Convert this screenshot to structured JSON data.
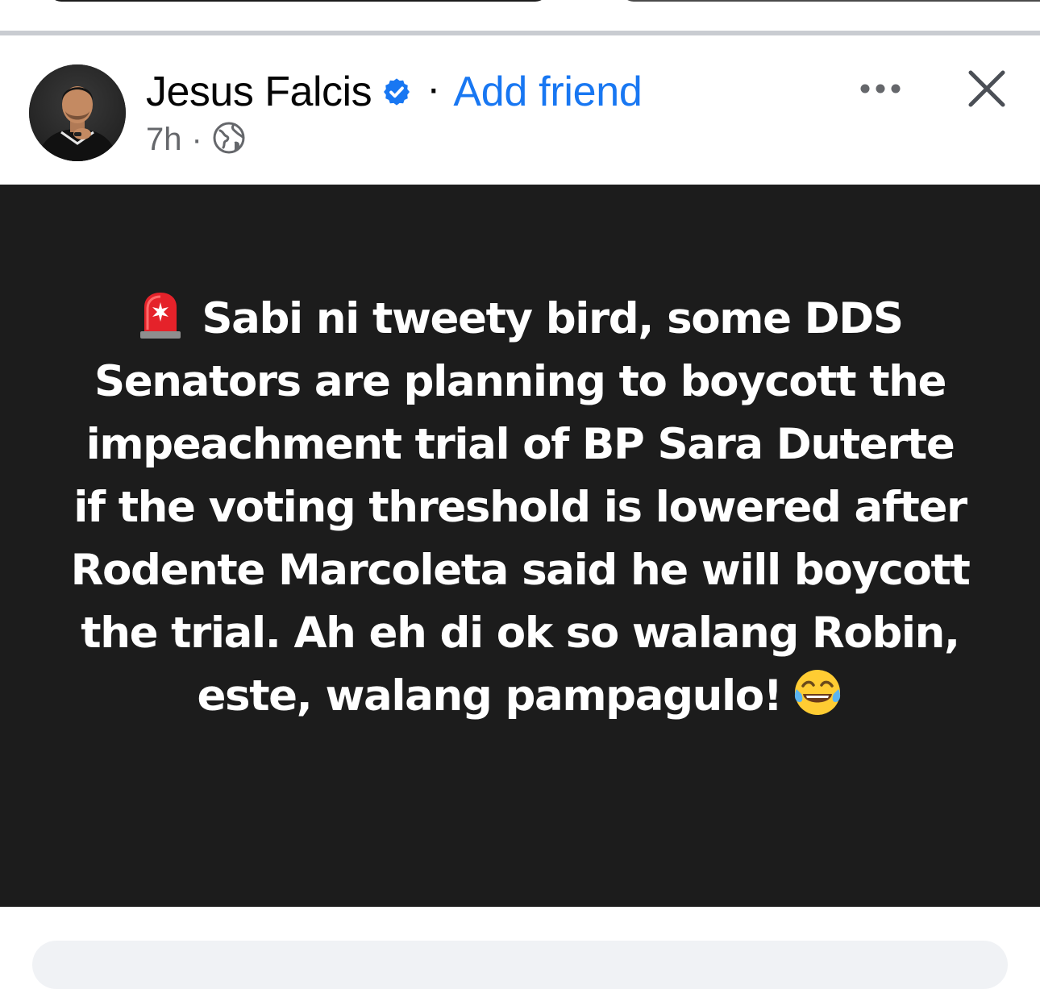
{
  "post": {
    "author": {
      "name": "Jesus Falcis",
      "verified": true,
      "avatar_icon": "person-avatar-icon"
    },
    "header": {
      "separator": "·",
      "add_friend_label": "Add friend",
      "time": "7h",
      "meta_separator": "·",
      "audience_icon": "globe-icon",
      "more_icon": "more-horizontal-icon",
      "close_icon": "close-icon"
    },
    "body": {
      "background_color": "#1c1c1c",
      "text_color": "#ffffff",
      "leading_emoji": "police-car-light-emoji",
      "text": "Sabi ni tweety bird, some DDS Senators are planning to boycott the impeachment trial of BP Sara Duterte if the voting threshold is lowered after Rodente Marcoleta said he will boycott the trial. Ah eh di ok so walang Robin, este, walang pampagulo!",
      "trailing_emoji": "face-with-tears-of-joy-emoji"
    }
  },
  "colors": {
    "link_blue": "#1877f2",
    "verified_blue": "#1877f2",
    "secondary_text": "#65676b",
    "divider": "#c9ccd1"
  }
}
